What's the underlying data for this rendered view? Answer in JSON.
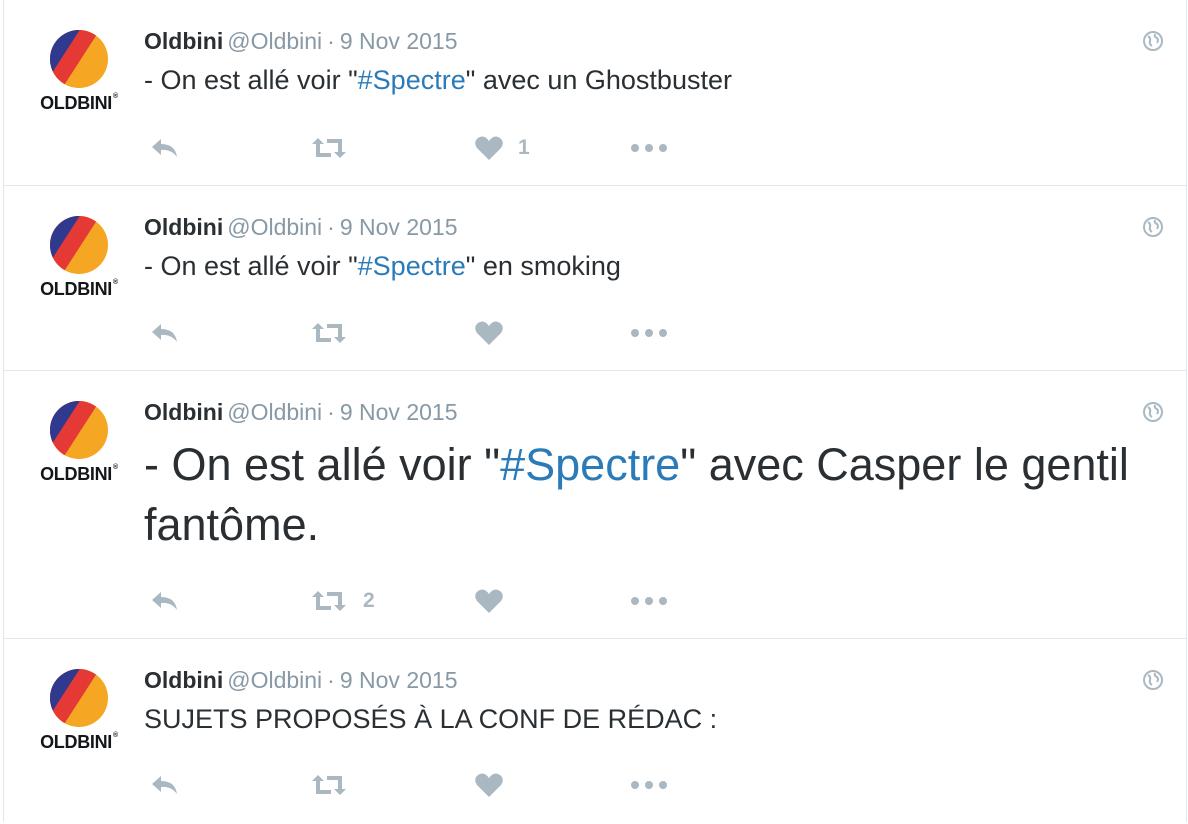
{
  "colors": {
    "accent": "#2b7bb9",
    "muted": "#8899a6",
    "icon": "#aab8c2",
    "text": "#292f33",
    "border": "#e1e8ed"
  },
  "icons": {
    "reply": "reply-icon",
    "retweet": "retweet-icon",
    "like": "heart-icon",
    "more": "more-icon",
    "globe": "globe-icon"
  },
  "tweets": [
    {
      "avatar_label": "OLDBINI",
      "name": "Oldbini",
      "handle": "@Oldbini",
      "separator": "·",
      "date": "9 Nov 2015",
      "text_before": "- On est allé voir \"",
      "hashtag": "#Spectre",
      "text_after": "\" avec un Ghostbuster",
      "retweets": "",
      "likes": "1"
    },
    {
      "avatar_label": "OLDBINI",
      "name": "Oldbini",
      "handle": "@Oldbini",
      "separator": "·",
      "date": "9 Nov 2015",
      "text_before": "- On est allé voir \"",
      "hashtag": "#Spectre",
      "text_after": "\" en smoking",
      "retweets": "",
      "likes": ""
    },
    {
      "avatar_label": "OLDBINI",
      "name": "Oldbini",
      "handle": "@Oldbini",
      "separator": "·",
      "date": "9 Nov 2015",
      "text_before": "- On est allé voir \"",
      "hashtag": "#Spectre",
      "text_after": "\" avec Casper le gentil fantôme.",
      "retweets": "2",
      "likes": ""
    },
    {
      "avatar_label": "OLDBINI",
      "name": "Oldbini",
      "handle": "@Oldbini",
      "separator": "·",
      "date": "9 Nov 2015",
      "text": "SUJETS PROPOSÉS À LA CONF DE RÉDAC :",
      "retweets": "",
      "likes": ""
    }
  ]
}
